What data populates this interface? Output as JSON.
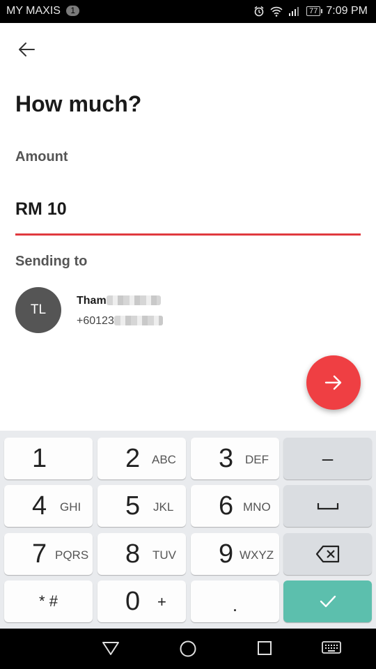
{
  "status_bar": {
    "carrier": "MY MAXIS",
    "notification_count": "1",
    "battery": "77",
    "time": "7:09 PM"
  },
  "page": {
    "title": "How much?",
    "amount_label": "Amount",
    "amount_value": "RM 10",
    "sending_label": "Sending to"
  },
  "recipient": {
    "initials": "TL",
    "name": "Tham",
    "phone": "+60123"
  },
  "keypad": {
    "k1": {
      "digit": "1",
      "letters": ""
    },
    "k2": {
      "digit": "2",
      "letters": "ABC"
    },
    "k3": {
      "digit": "3",
      "letters": "DEF"
    },
    "k4": {
      "digit": "4",
      "letters": "GHI"
    },
    "k5": {
      "digit": "5",
      "letters": "JKL"
    },
    "k6": {
      "digit": "6",
      "letters": "MNO"
    },
    "k7": {
      "digit": "7",
      "letters": "PQRS"
    },
    "k8": {
      "digit": "8",
      "letters": "TUV"
    },
    "k9": {
      "digit": "9",
      "letters": "WXYZ"
    },
    "k0": {
      "digit": "0",
      "letters": "+"
    },
    "star_hash": "* #",
    "dot": ".",
    "minus": "–"
  },
  "colors": {
    "accent_red": "#ef3f43",
    "underline_red": "#e0393e",
    "confirm_teal": "#5cbfad",
    "avatar_gray": "#555555"
  },
  "icons": {
    "back": "arrow-left-icon",
    "next": "arrow-right-icon",
    "space": "space-bar-icon",
    "backspace": "backspace-icon",
    "confirm": "checkmark-icon",
    "nav_back": "triangle-back-icon",
    "nav_home": "circle-home-icon",
    "nav_recents": "square-recents-icon",
    "nav_keyboard": "keyboard-icon"
  }
}
